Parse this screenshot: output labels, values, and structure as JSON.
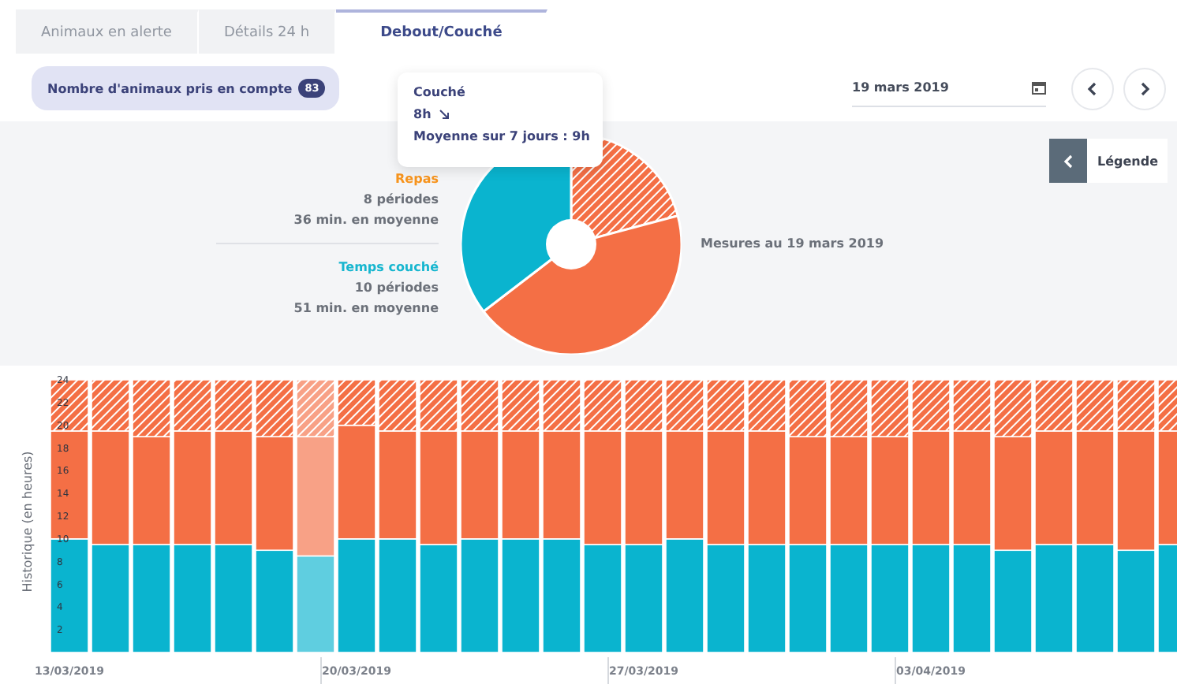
{
  "tabs": [
    {
      "label": "Animaux en alerte",
      "selected": false
    },
    {
      "label": "Détails 24 h",
      "selected": false
    },
    {
      "label": "Debout/Couché",
      "selected": true
    }
  ],
  "count_chip": {
    "label": "Nombre d'animaux pris en compte",
    "count": "83"
  },
  "date_field": {
    "value": "19 mars 2019"
  },
  "tooltip": {
    "title": "Couché",
    "value": "8h",
    "average": "Moyenne sur 7 jours : 9h"
  },
  "summary": {
    "groups": [
      {
        "title": "Repas",
        "color": "#f7941d",
        "lines": [
          "8 périodes",
          "36 min. en moyenne"
        ]
      },
      {
        "title": "Temps couché",
        "color": "#17b6cf",
        "lines": [
          "10 périodes",
          "51 min. en moyenne"
        ]
      }
    ],
    "caption": "Mesures au 19 mars 2019"
  },
  "legend_button": {
    "label": "Légende"
  },
  "history": {
    "series_styles": [
      {
        "hatched": false
      },
      {
        "hatched": false
      },
      {
        "hatched": true
      }
    ],
    "bar_states": [
      {
        "selected": false
      },
      {
        "selected": false
      },
      {
        "selected": false
      },
      {
        "selected": false
      },
      {
        "selected": false
      },
      {
        "selected": false
      },
      {
        "selected": true
      },
      {
        "selected": false
      },
      {
        "selected": false
      },
      {
        "selected": false
      },
      {
        "selected": false
      },
      {
        "selected": false
      },
      {
        "selected": false
      },
      {
        "selected": false
      },
      {
        "selected": false
      },
      {
        "selected": false
      },
      {
        "selected": false
      },
      {
        "selected": false
      },
      {
        "selected": false
      },
      {
        "selected": false
      },
      {
        "selected": false
      },
      {
        "selected": false
      },
      {
        "selected": false
      },
      {
        "selected": false
      },
      {
        "selected": false
      },
      {
        "selected": false
      },
      {
        "selected": false
      },
      {
        "selected": false
      }
    ],
    "chart_data": {
      "type": "bar",
      "stacked": true,
      "ylabel": "Historique (en heures)",
      "ylim": [
        0,
        24
      ],
      "yticks": [
        2,
        4,
        6,
        8,
        10,
        12,
        14,
        16,
        18,
        20,
        22,
        24
      ],
      "categories": [
        "13/03/2019",
        null,
        null,
        null,
        null,
        null,
        null,
        "20/03/2019",
        null,
        null,
        null,
        null,
        null,
        null,
        "27/03/2019",
        null,
        null,
        null,
        null,
        null,
        null,
        "03/04/2019",
        null,
        null,
        null,
        null,
        null,
        null
      ],
      "series": [
        {
          "color": "#0ab4cf",
          "values": [
            10,
            9.5,
            9.5,
            9.5,
            9.5,
            9,
            8.5,
            10,
            10,
            9.5,
            10,
            10,
            10,
            9.5,
            9.5,
            10,
            9.5,
            9.5,
            9.5,
            9.5,
            9.5,
            9.5,
            9.5,
            9,
            9.5,
            9.5,
            9,
            9.5
          ]
        },
        {
          "color": "#f46f45",
          "values": [
            9.5,
            10,
            9.5,
            10,
            10,
            10,
            10.5,
            10,
            9.5,
            10,
            9.5,
            9.5,
            9.5,
            10,
            10,
            9.5,
            10,
            10,
            9.5,
            9.5,
            9.5,
            10,
            10,
            10,
            10,
            10,
            10.5,
            10
          ]
        },
        {
          "color": "#f46f45",
          "values": [
            4.5,
            4.5,
            5,
            4.5,
            4.5,
            5,
            5,
            4,
            4.5,
            4.5,
            4.5,
            4.5,
            4.5,
            4.5,
            4.5,
            4.5,
            4.5,
            4.5,
            5,
            5,
            5,
            4.5,
            4.5,
            5,
            4.5,
            4.5,
            4.5,
            4.5
          ]
        }
      ]
    }
  }
}
